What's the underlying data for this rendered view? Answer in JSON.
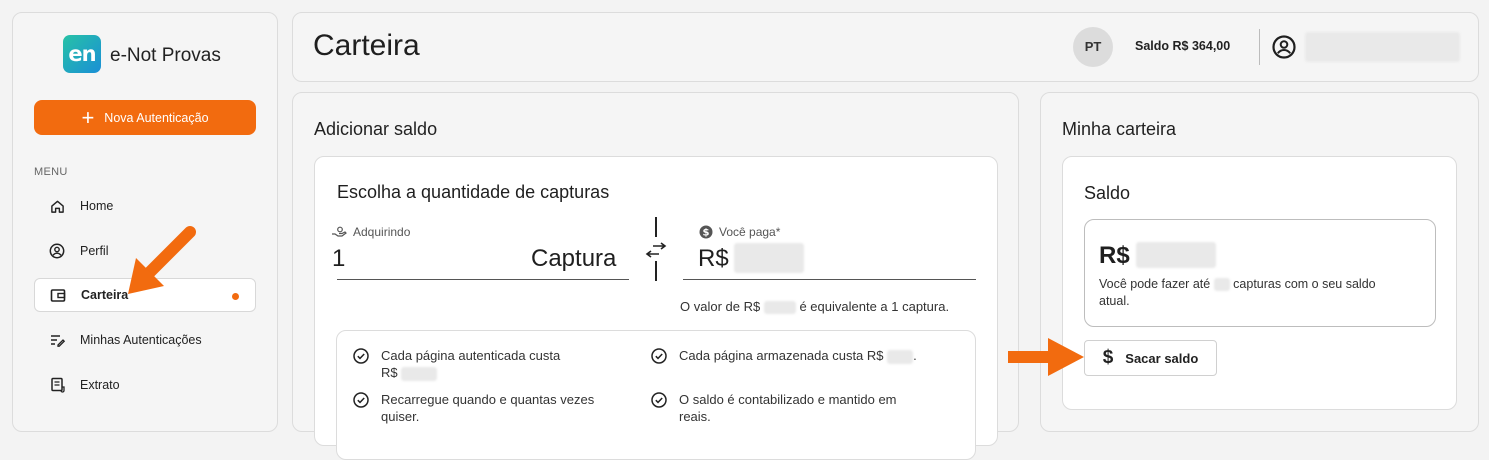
{
  "sidebar": {
    "logo_text": "en",
    "brand": "e-Not Provas",
    "new_button": "Nova Autenticação",
    "menu_label": "MENU",
    "items": [
      {
        "label": "Home",
        "icon": "home-icon"
      },
      {
        "label": "Perfil",
        "icon": "user-circle-icon"
      },
      {
        "label": "Carteira",
        "icon": "wallet-icon",
        "active": true
      },
      {
        "label": "Minhas Autenticações",
        "icon": "edit-list-icon"
      },
      {
        "label": "Extrato",
        "icon": "receipt-icon"
      }
    ]
  },
  "header": {
    "title": "Carteira",
    "avatar_initials": "PT",
    "balance": "Saldo R$ 364,00"
  },
  "add": {
    "title": "Adicionar saldo",
    "card_title": "Escolha a quantidade de capturas",
    "acquiring_label": "Adquirindo",
    "quantity": "1",
    "unit": "Captura",
    "pay_label": "Você paga*",
    "currency": "R$",
    "equiv_prefix": "O valor de R$",
    "equiv_suffix": "é equivalente a 1 captura.",
    "features": [
      {
        "line1": "Cada página autenticada custa",
        "line2": "R$"
      },
      {
        "line1": "Cada página armazenada custa R$",
        "line2": "."
      },
      {
        "line1": "Recarregue quando e quantas vezes",
        "line2": "quiser."
      },
      {
        "line1": "O saldo é contabilizado e mantido em",
        "line2": "reais."
      }
    ]
  },
  "wallet": {
    "title": "Minha carteira",
    "card_title": "Saldo",
    "currency": "R$",
    "msg_prefix": "Você pode fazer até",
    "msg_suffix": "capturas com o seu saldo",
    "msg_line2": "atual.",
    "withdraw_button": "Sacar saldo"
  },
  "colors": {
    "accent": "#f26b0f"
  }
}
